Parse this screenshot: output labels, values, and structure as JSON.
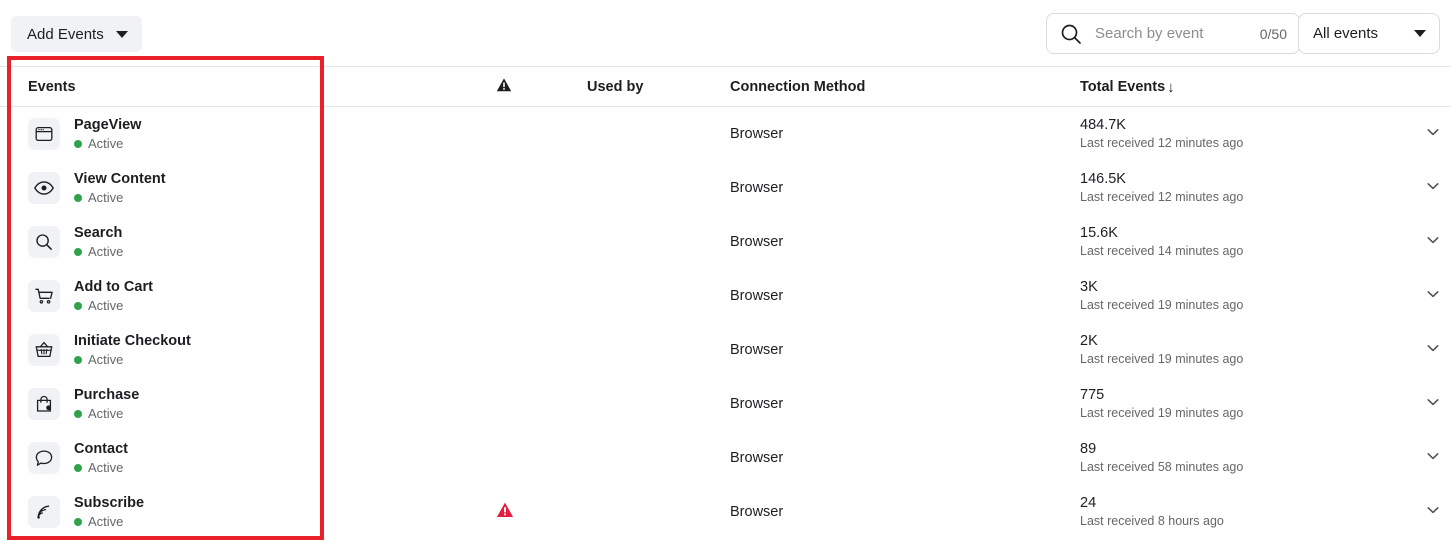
{
  "toolbar": {
    "add_events_label": "Add Events",
    "add_events_caret_icon": "chevron-down-icon",
    "search": {
      "placeholder": "Search by event",
      "value": "",
      "counter": "0/50",
      "icon": "search-icon"
    },
    "filter": {
      "selected": "All events",
      "caret_icon": "chevron-down-icon"
    }
  },
  "table": {
    "headers": {
      "events": "Events",
      "alert_icon": "warning-triangle-icon",
      "used_by": "Used by",
      "connection_method": "Connection Method",
      "total_events": "Total Events",
      "sort_arrow": "↓"
    },
    "rows": [
      {
        "icon": "browser-window-icon",
        "name": "PageView",
        "status": "Active",
        "alert": false,
        "used_by": "",
        "connection_method": "Browser",
        "total_events": "484.7K",
        "last_received": "Last received 12 minutes ago",
        "expand_icon": "chevron-down-icon"
      },
      {
        "icon": "eye-icon",
        "name": "View Content",
        "status": "Active",
        "alert": false,
        "used_by": "",
        "connection_method": "Browser",
        "total_events": "146.5K",
        "last_received": "Last received 12 minutes ago",
        "expand_icon": "chevron-down-icon"
      },
      {
        "icon": "magnifier-icon",
        "name": "Search",
        "status": "Active",
        "alert": false,
        "used_by": "",
        "connection_method": "Browser",
        "total_events": "15.6K",
        "last_received": "Last received 14 minutes ago",
        "expand_icon": "chevron-down-icon"
      },
      {
        "icon": "shopping-cart-icon",
        "name": "Add to Cart",
        "status": "Active",
        "alert": false,
        "used_by": "",
        "connection_method": "Browser",
        "total_events": "3K",
        "last_received": "Last received 19 minutes ago",
        "expand_icon": "chevron-down-icon"
      },
      {
        "icon": "shopping-basket-icon",
        "name": "Initiate Checkout",
        "status": "Active",
        "alert": false,
        "used_by": "",
        "connection_method": "Browser",
        "total_events": "2K",
        "last_received": "Last received 19 minutes ago",
        "expand_icon": "chevron-down-icon"
      },
      {
        "icon": "shopping-bag-icon",
        "name": "Purchase",
        "status": "Active",
        "alert": false,
        "used_by": "",
        "connection_method": "Browser",
        "total_events": "775",
        "last_received": "Last received 19 minutes ago",
        "expand_icon": "chevron-down-icon"
      },
      {
        "icon": "speech-bubble-icon",
        "name": "Contact",
        "status": "Active",
        "alert": false,
        "used_by": "",
        "connection_method": "Browser",
        "total_events": "89",
        "last_received": "Last received 58 minutes ago",
        "expand_icon": "chevron-down-icon"
      },
      {
        "icon": "rss-feed-icon",
        "name": "Subscribe",
        "status": "Active",
        "alert": true,
        "alert_icon": "warning-triangle-icon",
        "used_by": "",
        "connection_method": "Browser",
        "total_events": "24",
        "last_received": "Last received 8 hours ago",
        "expand_icon": "chevron-down-icon"
      }
    ]
  },
  "annotation": {
    "highlight_box_color": "#e8202a"
  },
  "colors": {
    "status_active": "#31a24c",
    "alert_red": "#e41e3f",
    "text_primary": "#1c1e21",
    "text_secondary": "#65676b",
    "chip_bg": "#f0f2f5",
    "border": "#e4e6eb"
  }
}
